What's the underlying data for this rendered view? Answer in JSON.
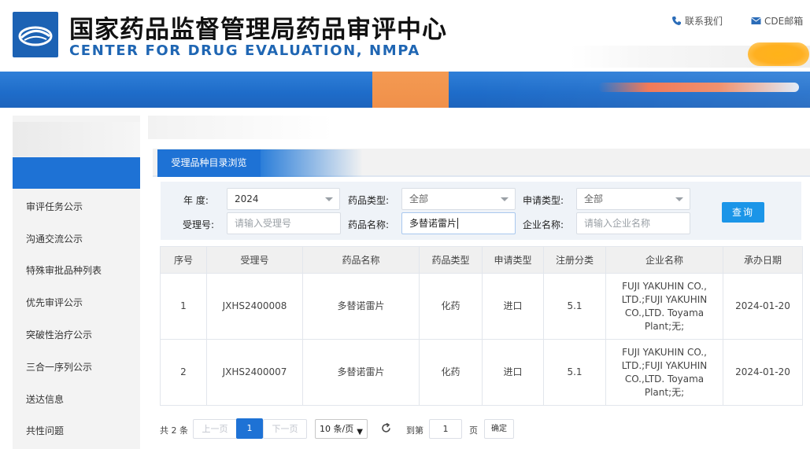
{
  "header": {
    "title_cn": "国家药品监督管理局药品审评中心",
    "title_en": "CENTER FOR DRUG EVALUATION, NMPA",
    "contact_label": "联系我们",
    "cde_mail_label": "CDE邮箱",
    "brand_color": "#1f66b3"
  },
  "sidebar": {
    "items": [
      {
        "label": "审评任务公示"
      },
      {
        "label": "沟通交流公示"
      },
      {
        "label": "特殊审批品种列表"
      },
      {
        "label": "优先审评公示"
      },
      {
        "label": "突破性治疗公示"
      },
      {
        "label": "三合一序列公示"
      },
      {
        "label": "送达信息"
      },
      {
        "label": "共性问题"
      }
    ],
    "active_color": "#1e72d5"
  },
  "tab": {
    "active_label": "受理品种目录浏览"
  },
  "form": {
    "year_label": "年  度:",
    "year_value": "2024",
    "drug_type_label": "药品类型:",
    "drug_type_value": "全部",
    "apply_type_label": "申请类型:",
    "apply_type_value": "全部",
    "accept_no_label": "受理号:",
    "accept_no_placeholder": "请输入受理号",
    "drug_name_label": "药品名称:",
    "drug_name_value": "多替诺雷片",
    "company_label": "企业名称:",
    "company_placeholder": "请输入企业名称",
    "search_button": "查询"
  },
  "table": {
    "headers": [
      "序号",
      "受理号",
      "药品名称",
      "药品类型",
      "申请类型",
      "注册分类",
      "企业名称",
      "承办日期"
    ],
    "rows": [
      [
        "1",
        "JXHS2400008",
        "多替诺雷片",
        "化药",
        "进口",
        "5.1",
        "FUJI YAKUHIN CO., LTD.;FUJI YAKUHIN CO.,LTD. Toyama Plant;无;",
        "2024-01-20"
      ],
      [
        "2",
        "JXHS2400007",
        "多替诺雷片",
        "化药",
        "进口",
        "5.1",
        "FUJI YAKUHIN CO., LTD.;FUJI YAKUHIN CO.,LTD. Toyama Plant;无;",
        "2024-01-20"
      ]
    ]
  },
  "pagination": {
    "total": "共 2 条",
    "prev": "上一页",
    "current_page": "1",
    "next": "下一页",
    "page_size": "10 条/页",
    "goto_label": "到第",
    "goto_value": "1",
    "page_unit": "页",
    "confirm": "确定"
  },
  "icons": {
    "logo": "cde-logo-icon",
    "contact": "phone-icon",
    "mail": "mail-icon",
    "refresh": "refresh-icon",
    "dropdown": "chevron-down-icon"
  }
}
